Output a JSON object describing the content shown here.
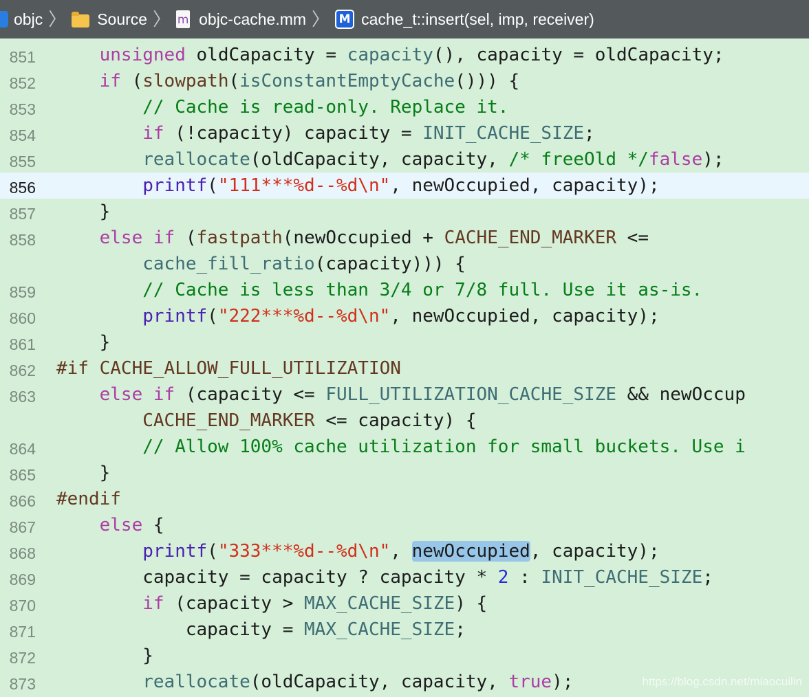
{
  "breadcrumb": {
    "items": [
      {
        "label": "objc",
        "icon": "project-icon"
      },
      {
        "label": "Source",
        "icon": "folder-icon"
      },
      {
        "label": "objc-cache.mm",
        "icon": "objc-file-icon",
        "glyph": "m"
      },
      {
        "label": "cache_t::insert(sel, imp, receiver)",
        "icon": "method-icon",
        "glyph": "M"
      }
    ]
  },
  "editor": {
    "current_line": "856",
    "lines": [
      {
        "no": "851",
        "code": "    unsigned oldCapacity = capacity(), capacity = oldCapacity;"
      },
      {
        "no": "852",
        "code": "    if (slowpath(isConstantEmptyCache())) {"
      },
      {
        "no": "853",
        "code": "        // Cache is read-only. Replace it."
      },
      {
        "no": "854",
        "code": "        if (!capacity) capacity = INIT_CACHE_SIZE;"
      },
      {
        "no": "855",
        "code": "        reallocate(oldCapacity, capacity, /* freeOld */false);"
      },
      {
        "no": "856",
        "code": "        printf(\"111***%d--%d\\n\", newOccupied, capacity);"
      },
      {
        "no": "857",
        "code": "    }"
      },
      {
        "no": "858",
        "code": "    else if (fastpath(newOccupied + CACHE_END_MARKER <="
      },
      {
        "no": "",
        "code": "        cache_fill_ratio(capacity))) {"
      },
      {
        "no": "859",
        "code": "        // Cache is less than 3/4 or 7/8 full. Use it as-is."
      },
      {
        "no": "860",
        "code": "        printf(\"222***%d--%d\\n\", newOccupied, capacity);"
      },
      {
        "no": "861",
        "code": "    }"
      },
      {
        "no": "862",
        "code": "#if CACHE_ALLOW_FULL_UTILIZATION"
      },
      {
        "no": "863",
        "code": "    else if (capacity <= FULL_UTILIZATION_CACHE_SIZE && newOccup"
      },
      {
        "no": "",
        "code": "        CACHE_END_MARKER <= capacity) {"
      },
      {
        "no": "864",
        "code": "        // Allow 100% cache utilization for small buckets. Use i"
      },
      {
        "no": "865",
        "code": "    }"
      },
      {
        "no": "866",
        "code": "#endif"
      },
      {
        "no": "867",
        "code": "    else {"
      },
      {
        "no": "868",
        "code": "        printf(\"333***%d--%d\\n\", newOccupied, capacity);"
      },
      {
        "no": "869",
        "code": "        capacity = capacity ? capacity * 2 : INIT_CACHE_SIZE;"
      },
      {
        "no": "870",
        "code": "        if (capacity > MAX_CACHE_SIZE) {"
      },
      {
        "no": "871",
        "code": "            capacity = MAX_CACHE_SIZE;"
      },
      {
        "no": "872",
        "code": "        }"
      },
      {
        "no": "873",
        "code": "        reallocate(oldCapacity, capacity, true);"
      }
    ],
    "highlighted_token": "newOccupied"
  },
  "watermark": "https://blog.csdn.net/miaocuilin",
  "colors": {
    "background": "#d5efd9",
    "current_line": "#eaf6fd",
    "keyword": "#ad3da4",
    "comment": "#077d17",
    "string": "#d12f1b",
    "number": "#272ad8",
    "function": "#3e6d74",
    "macro": "#643820",
    "selection": "#97c6e8"
  }
}
